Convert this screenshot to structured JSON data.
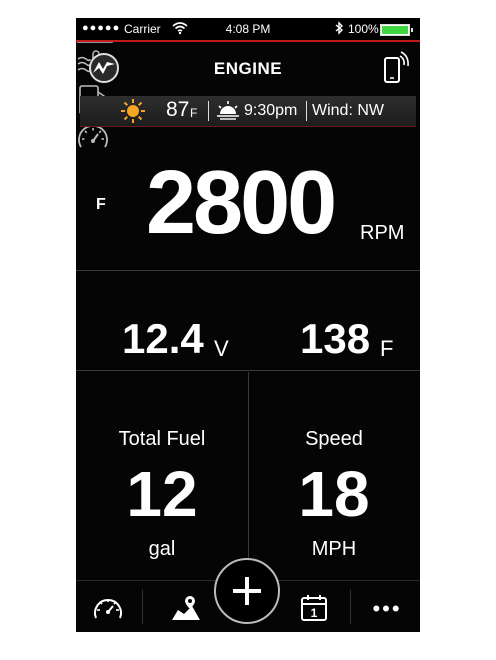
{
  "status_bar": {
    "signal": "●●●●●",
    "carrier": "Carrier",
    "time": "4:08 PM",
    "battery": "100%"
  },
  "header": {
    "title": "ENGINE"
  },
  "weather": {
    "temperature": "87",
    "temperature_unit": "F",
    "sunset_time": "9:30pm",
    "wind": "Wind: NW"
  },
  "rpm": {
    "side": "F",
    "value": "2800",
    "unit": "RPM"
  },
  "battery_voltage": {
    "value": "12.4",
    "unit": "V"
  },
  "water_temp": {
    "value": "138",
    "unit": "F"
  },
  "fuel": {
    "label": "Total Fuel",
    "value": "12",
    "unit": "gal"
  },
  "speed": {
    "label": "Speed",
    "value": "18",
    "unit": "MPH"
  },
  "nav": {
    "calendar_day": "1",
    "more": "•••"
  },
  "colors": {
    "accent_red": "#c21b1b",
    "sun_orange": "#f5a623",
    "battery_green": "#3fd63f"
  }
}
